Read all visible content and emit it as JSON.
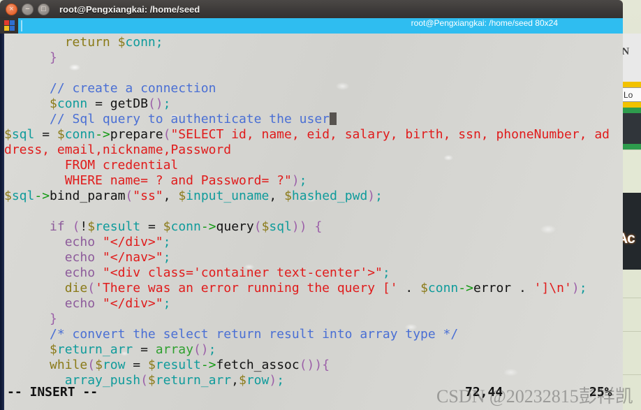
{
  "window": {
    "title": "root@Pengxiangkai: /home/seed",
    "close_label": "×",
    "minimize_label": "−",
    "maximize_label": "□"
  },
  "tab": {
    "title": "root@Pengxiangkai: /home/seed 80x24",
    "icon": "terminal-tab-icon"
  },
  "editor": {
    "lines": [
      {
        "id": 1,
        "indent": 4,
        "text": "return $conn;"
      },
      {
        "id": 2,
        "indent": 3,
        "text": "}"
      },
      {
        "id": 3,
        "indent": 0,
        "text": ""
      },
      {
        "id": 4,
        "indent": 3,
        "text": "// create a connection"
      },
      {
        "id": 5,
        "indent": 3,
        "text": "$conn = getDB();"
      },
      {
        "id": 6,
        "indent": 3,
        "text": "// Sql query to authenticate the user"
      },
      {
        "id": 7,
        "indent": 0,
        "text": "$sql = $conn->prepare(\"SELECT id, name, eid, salary, birth, ssn, phoneNumber, ad"
      },
      {
        "id": 8,
        "indent": 0,
        "text": "dress, email,nickname,Password"
      },
      {
        "id": 9,
        "indent": 5,
        "text": "FROM credential"
      },
      {
        "id": 10,
        "indent": 5,
        "text": "WHERE name= ? and Password= ?\");"
      },
      {
        "id": 11,
        "indent": 0,
        "text": "$sql->bind_param(\"ss\", $input_uname, $hashed_pwd);"
      },
      {
        "id": 12,
        "indent": 0,
        "text": ""
      },
      {
        "id": 13,
        "indent": 3,
        "text": "if (!$result = $conn->query($sql)) {"
      },
      {
        "id": 14,
        "indent": 4,
        "text": "echo \"</div>\";"
      },
      {
        "id": 15,
        "indent": 4,
        "text": "echo \"</nav>\";"
      },
      {
        "id": 16,
        "indent": 4,
        "text": "echo \"<div class='container text-center'>\";"
      },
      {
        "id": 17,
        "indent": 4,
        "text": "die('There was an error running the query [' . $conn->error . ']\\n');"
      },
      {
        "id": 18,
        "indent": 4,
        "text": "echo \"</div>\";"
      },
      {
        "id": 19,
        "indent": 3,
        "text": "}"
      },
      {
        "id": 20,
        "indent": 3,
        "text": "/* convert the select return result into array type */"
      },
      {
        "id": 21,
        "indent": 3,
        "text": "$return_arr = array();"
      },
      {
        "id": 22,
        "indent": 3,
        "text": "while($row = $result->fetch_assoc()){"
      },
      {
        "id": 23,
        "indent": 4,
        "text": "array_push($return_arr,$row);"
      }
    ]
  },
  "statusline": {
    "mode": "-- INSERT --",
    "position": "72,44",
    "percent": "25%"
  },
  "watermark": {
    "text": "CSDN @20232815彭祥凯"
  },
  "background": {
    "browser_label": "llN",
    "yellow_button_label": "Lo",
    "dark_panel_label": "Ac"
  },
  "colors": {
    "tab_active": "#2fbdf0",
    "titlebar": "#3c3938",
    "terminal_bg": "#d6d6d2",
    "comment": "#4a6fd4",
    "string": "#e01b1b",
    "variable": "#0f9b9b",
    "keyword": "#8d5b9b",
    "arrow": "#119911"
  }
}
